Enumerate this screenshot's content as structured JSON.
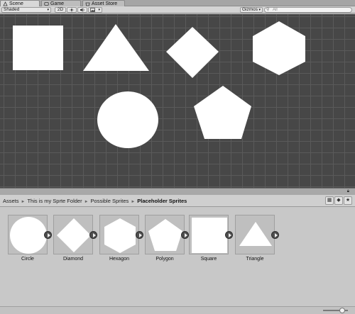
{
  "tabs": [
    {
      "label": "Scene",
      "icon": "scene-tab-icon",
      "active": true
    },
    {
      "label": "Game",
      "icon": "game-tab-icon",
      "active": false
    },
    {
      "label": "Asset Store",
      "icon": "asset-store-tab-icon",
      "active": false
    }
  ],
  "toolbar": {
    "shading_mode": "Shaded",
    "mode_2d": "2D",
    "lighting_icon": "sun-icon",
    "audio_icon": "speaker-icon",
    "effects_icon": "image-icon",
    "gizmos_label": "Gizmos",
    "search_placeholder": "All"
  },
  "scene": {
    "background_color": "#474747",
    "grid_color": "#5a5a5a",
    "shape_color": "#ffffff",
    "shapes": [
      "square",
      "triangle",
      "diamond",
      "hexagon",
      "circle",
      "pentagon"
    ]
  },
  "project": {
    "breadcrumb": [
      "Assets",
      "This is my Sprte Folder",
      "Possible Sprites",
      "Placeholder Sprites"
    ],
    "breadcrumb_separator": "►",
    "tool_icons": [
      "type-filter-icon",
      "label-filter-icon",
      "favorite-star-icon"
    ],
    "assets": [
      {
        "name": "Circle",
        "shape": "circle"
      },
      {
        "name": "Diamond",
        "shape": "diamond"
      },
      {
        "name": "Hexagon",
        "shape": "hexagon"
      },
      {
        "name": "Polygon",
        "shape": "pentagon"
      },
      {
        "name": "Square",
        "shape": "square"
      },
      {
        "name": "Triangle",
        "shape": "triangle"
      }
    ],
    "zoom_level": 0.85
  }
}
